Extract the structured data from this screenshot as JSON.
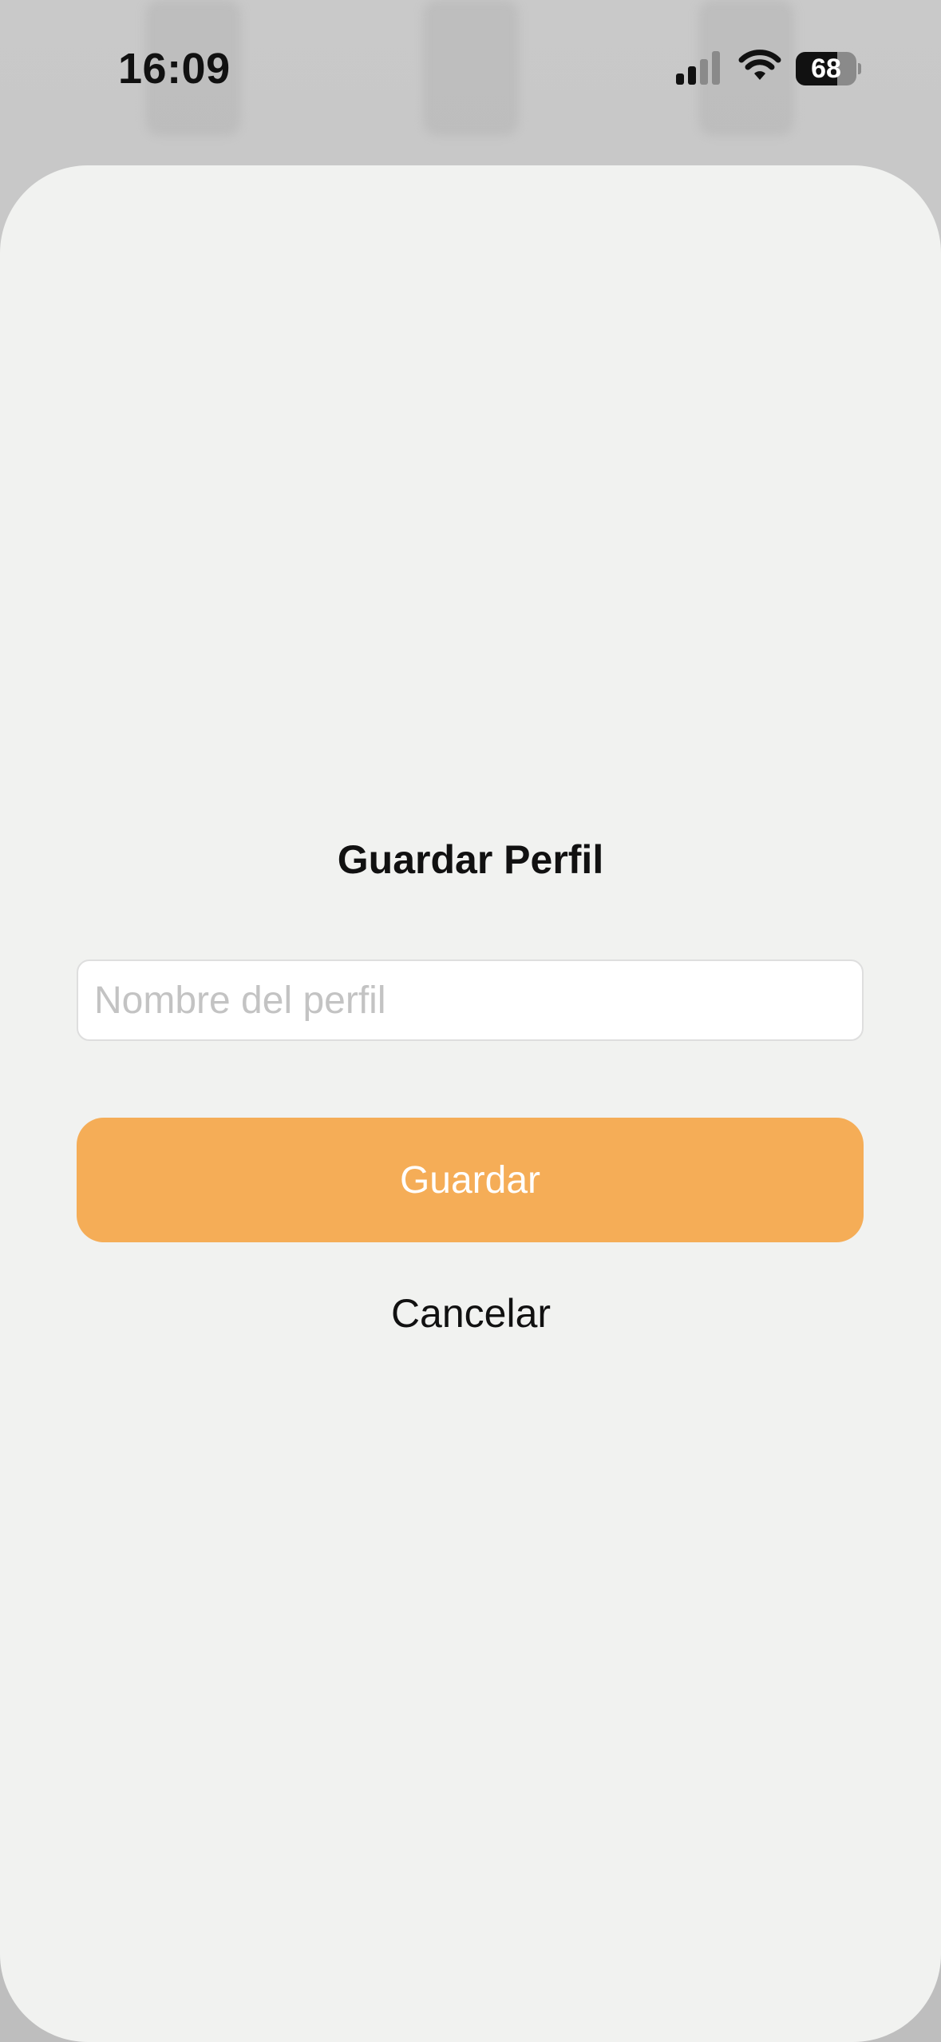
{
  "status_bar": {
    "time": "16:09",
    "battery_level": "68",
    "battery_fraction": 0.68,
    "icons": [
      "cellular-signal-icon",
      "wifi-icon",
      "battery-icon"
    ]
  },
  "dialog": {
    "title": "Guardar Perfil",
    "name_input": {
      "value": "",
      "placeholder": "Nombre del perfil"
    },
    "save_label": "Guardar",
    "cancel_label": "Cancelar"
  },
  "colors": {
    "accent": "#f5ad57",
    "sheet_background": "#f1f2f0",
    "backdrop": "#c4c4c4"
  }
}
